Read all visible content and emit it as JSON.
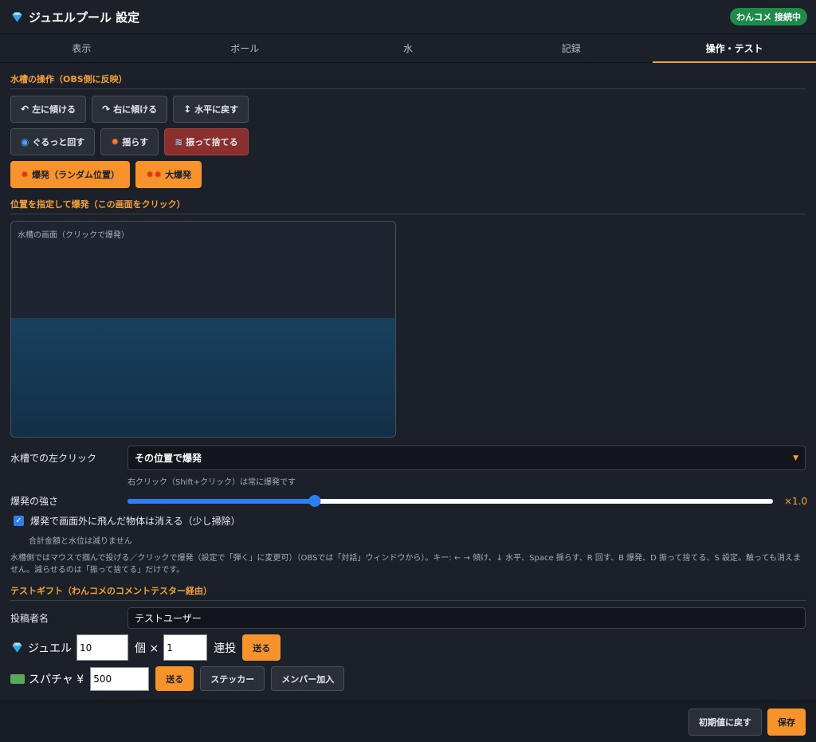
{
  "header": {
    "title": "ジュエルプール 設定",
    "badge": "わんコメ 接続中"
  },
  "tabs": [
    {
      "label": "表示"
    },
    {
      "label": "ボール"
    },
    {
      "label": "水"
    },
    {
      "label": "記録"
    },
    {
      "label": "操作・テスト"
    }
  ],
  "tank_ops": {
    "title": "水槽の操作（OBS側に反映）",
    "tilt_left": "左に傾ける",
    "tilt_right": "右に傾ける",
    "level": "水平に戻す",
    "rotate": "ぐるっと回す",
    "shake": "揺らす",
    "dump": "振って捨てる",
    "explode_random": "爆発（ランダム位置）",
    "big_explode": "大爆発"
  },
  "position_explode": {
    "title": "位置を指定して爆発（この画面をクリック）",
    "tank_label": "水槽の画面（クリックで爆発）"
  },
  "settings": {
    "left_click_label": "水槽での左クリック",
    "left_click_value": "その位置で爆発",
    "right_click_hint": "右クリック（Shift+クリック）は常に爆発です",
    "strength_label": "爆発の強さ",
    "strength_value": "×1.0",
    "strength_level": 0.29,
    "vanish_label": "爆発で画面外に飛んだ物体は消える（少し掃除）",
    "vanish_hint": "合計金額と水位は減りません",
    "help_text": "水槽側ではマウスで掴んで投げる／クリックで爆発（設定で「弾く」に変更可）（OBSでは「対話」ウィンドウから）。キー: ← → 傾け、↓ 水平、Space 揺らす、R 回す、B 爆発、D 振って捨てる、S 設定。触っても消えません。減らせるのは「振って捨てる」だけです。"
  },
  "test_gift": {
    "title": "テストギフト（わんコメのコメントテスター経由）",
    "poster_label": "投稿者名",
    "poster_value": "テストユーザー",
    "jewel_label": "ジュエル",
    "jewel_count": "10",
    "unit": "個 ×",
    "jewel_repeat": "1",
    "repeat_label": "連投",
    "send": "送る",
    "superchat_label": "スパチャ ¥",
    "superchat_value": "500",
    "send2": "送る",
    "sticker": "ステッカー",
    "member": "メンバー加入"
  },
  "footer": {
    "reset": "初期値に戻す",
    "save": "保存"
  },
  "colors": {
    "accent": "#f5a03a",
    "danger": "#8a2e2e",
    "connected": "#1f8a4c",
    "slider": "#2d7ff0"
  }
}
